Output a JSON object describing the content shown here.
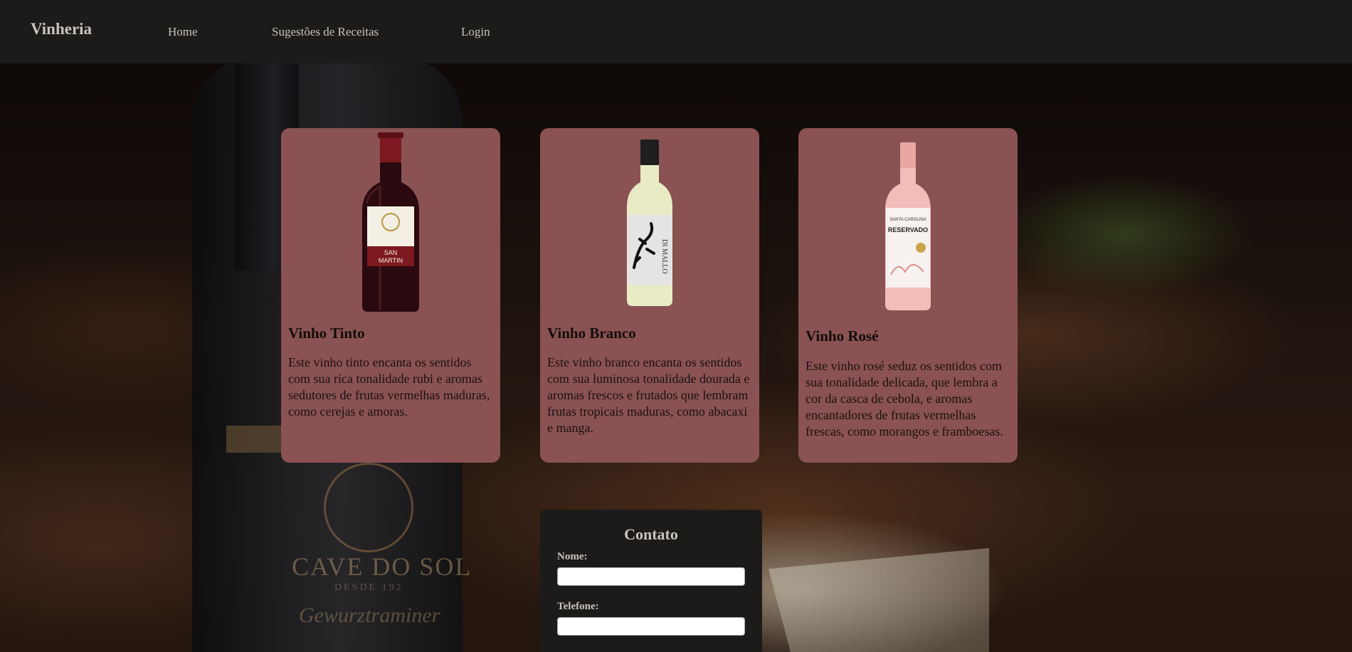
{
  "navbar": {
    "brand": "Vinheria",
    "links": [
      "Home",
      "Sugestões de Receitas",
      "Login"
    ]
  },
  "background": {
    "brand": "CAVE DO SOL",
    "brand_sub": "DESDE 192",
    "script": "Gewurztraminer"
  },
  "cards": [
    {
      "title": "Vinho Tinto",
      "description": "Este vinho tinto encanta os sentidos com sua rica tonalidade rubi e aromas sedutores de frutas vermelhas maduras, como cerejas e amoras.",
      "bottle_label": [
        "SAN",
        "MARTIN"
      ],
      "bottle_color": "#3a0c10"
    },
    {
      "title": "Vinho Branco",
      "description": "Este vinho branco encanta os sentidos com sua luminosa tonalidade dourada e aromas frescos e frutados que lembram frutas tropicais maduras, como abacaxi e manga.",
      "bottle_label": [
        "DI MALLO"
      ],
      "bottle_color": "#e6e7c6"
    },
    {
      "title": "Vinho Rosé",
      "description": "Este vinho rosé seduz os sentidos com sua tonalidade delicada, que lembra a cor da casca de cebola, e aromas encantadores de frutas vermelhas frescas, como morangos e framboesas.",
      "bottle_label": [
        "SANTA CAROLINA",
        "RESERVADO"
      ],
      "bottle_color": "#f1b9b6"
    }
  ],
  "contact": {
    "title": "Contato",
    "fields": [
      {
        "label": "Nome:",
        "value": "",
        "placeholder": ""
      },
      {
        "label": "Telefone:",
        "value": "",
        "placeholder": ""
      }
    ]
  },
  "colors": {
    "navbar": "#1d1b19",
    "card": "#8a5253",
    "text_light": "#c9c3bd"
  }
}
